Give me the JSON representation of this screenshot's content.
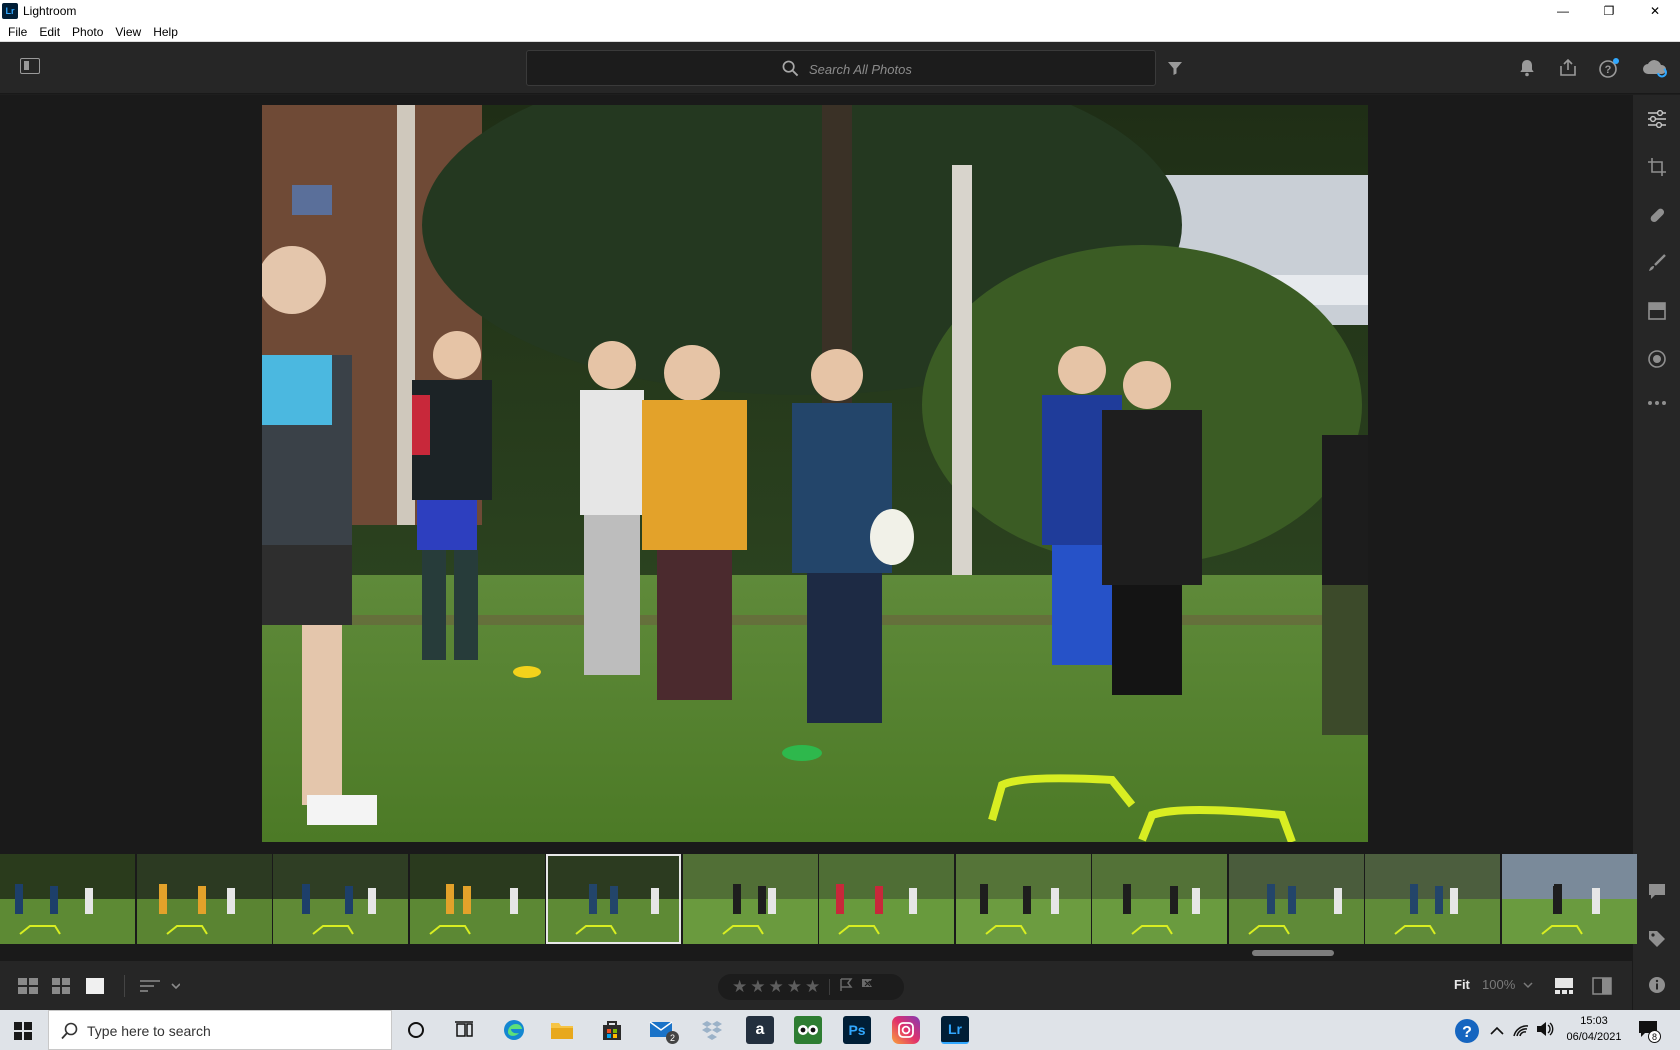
{
  "window": {
    "app_icon_label": "Lr",
    "title": "Lightroom",
    "minimize_glyph": "—",
    "restore_glyph": "❐",
    "close_glyph": "✕"
  },
  "menu": {
    "items": [
      "File",
      "Edit",
      "Photo",
      "View",
      "Help"
    ]
  },
  "toolbar": {
    "search_placeholder": "Search All Photos",
    "icons": [
      "panel-toggle-icon",
      "search-icon",
      "filter-icon",
      "bell-icon",
      "share-icon",
      "help-icon",
      "cloud-sync-icon"
    ]
  },
  "edit_panel": {
    "tools": [
      "edit-sliders-icon",
      "crop-icon",
      "healing-icon",
      "brush-icon",
      "linear-gradient-icon",
      "radial-gradient-icon",
      "more-icon"
    ],
    "bottom_tools": [
      "comments-icon",
      "keywords-icon",
      "info-icon"
    ]
  },
  "filmstrip": {
    "thumbnail_count": 12,
    "selected_index": 4
  },
  "bottom_bar": {
    "view_icons": [
      "square-grid-icon",
      "grid-icon",
      "detail-view-icon",
      "sort-icon"
    ],
    "star_glyph": "★",
    "rating_stars": 5,
    "rating_value": 0,
    "flag_icons": [
      "pick-flag-icon",
      "reject-flag-icon"
    ],
    "zoom_fit": "Fit",
    "zoom_percent": "100%",
    "right_icons": [
      "filmstrip-toggle-icon",
      "compare-icon"
    ]
  },
  "taskbar": {
    "search_placeholder": "Type here to search",
    "mail_badge": "2",
    "notification_badge": "8",
    "time": "15:03",
    "date": "06/04/2021",
    "ps_label": "Ps",
    "lr_label": "Lr",
    "amazon_label": "a",
    "apps": [
      "cortana-icon",
      "task-view-icon",
      "edge-icon",
      "file-explorer-icon",
      "store-icon",
      "mail-icon",
      "dropbox-icon",
      "amazon-icon",
      "tripadvisor-icon",
      "photoshop-icon",
      "instagram-icon",
      "lightroom-icon"
    ]
  },
  "colors": {
    "accent": "#31a8ff",
    "chrome_dark": "#262626",
    "canvas": "#1a1a1a"
  }
}
